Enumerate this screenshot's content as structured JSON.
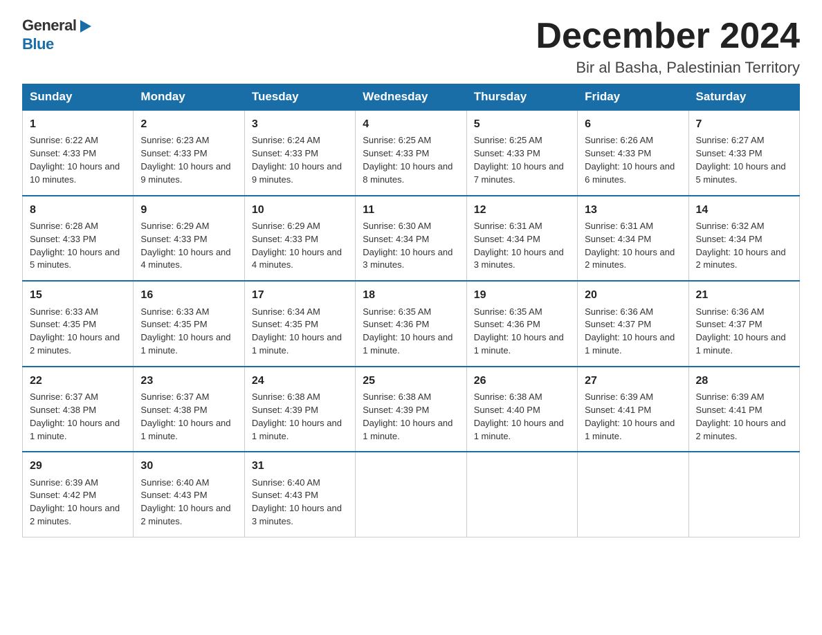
{
  "header": {
    "logo_general": "General",
    "logo_blue": "Blue",
    "month_title": "December 2024",
    "location": "Bir al Basha, Palestinian Territory"
  },
  "days_of_week": [
    "Sunday",
    "Monday",
    "Tuesday",
    "Wednesday",
    "Thursday",
    "Friday",
    "Saturday"
  ],
  "weeks": [
    [
      {
        "day": "1",
        "sunrise": "6:22 AM",
        "sunset": "4:33 PM",
        "daylight": "10 hours and 10 minutes."
      },
      {
        "day": "2",
        "sunrise": "6:23 AM",
        "sunset": "4:33 PM",
        "daylight": "10 hours and 9 minutes."
      },
      {
        "day": "3",
        "sunrise": "6:24 AM",
        "sunset": "4:33 PM",
        "daylight": "10 hours and 9 minutes."
      },
      {
        "day": "4",
        "sunrise": "6:25 AM",
        "sunset": "4:33 PM",
        "daylight": "10 hours and 8 minutes."
      },
      {
        "day": "5",
        "sunrise": "6:25 AM",
        "sunset": "4:33 PM",
        "daylight": "10 hours and 7 minutes."
      },
      {
        "day": "6",
        "sunrise": "6:26 AM",
        "sunset": "4:33 PM",
        "daylight": "10 hours and 6 minutes."
      },
      {
        "day": "7",
        "sunrise": "6:27 AM",
        "sunset": "4:33 PM",
        "daylight": "10 hours and 5 minutes."
      }
    ],
    [
      {
        "day": "8",
        "sunrise": "6:28 AM",
        "sunset": "4:33 PM",
        "daylight": "10 hours and 5 minutes."
      },
      {
        "day": "9",
        "sunrise": "6:29 AM",
        "sunset": "4:33 PM",
        "daylight": "10 hours and 4 minutes."
      },
      {
        "day": "10",
        "sunrise": "6:29 AM",
        "sunset": "4:33 PM",
        "daylight": "10 hours and 4 minutes."
      },
      {
        "day": "11",
        "sunrise": "6:30 AM",
        "sunset": "4:34 PM",
        "daylight": "10 hours and 3 minutes."
      },
      {
        "day": "12",
        "sunrise": "6:31 AM",
        "sunset": "4:34 PM",
        "daylight": "10 hours and 3 minutes."
      },
      {
        "day": "13",
        "sunrise": "6:31 AM",
        "sunset": "4:34 PM",
        "daylight": "10 hours and 2 minutes."
      },
      {
        "day": "14",
        "sunrise": "6:32 AM",
        "sunset": "4:34 PM",
        "daylight": "10 hours and 2 minutes."
      }
    ],
    [
      {
        "day": "15",
        "sunrise": "6:33 AM",
        "sunset": "4:35 PM",
        "daylight": "10 hours and 2 minutes."
      },
      {
        "day": "16",
        "sunrise": "6:33 AM",
        "sunset": "4:35 PM",
        "daylight": "10 hours and 1 minute."
      },
      {
        "day": "17",
        "sunrise": "6:34 AM",
        "sunset": "4:35 PM",
        "daylight": "10 hours and 1 minute."
      },
      {
        "day": "18",
        "sunrise": "6:35 AM",
        "sunset": "4:36 PM",
        "daylight": "10 hours and 1 minute."
      },
      {
        "day": "19",
        "sunrise": "6:35 AM",
        "sunset": "4:36 PM",
        "daylight": "10 hours and 1 minute."
      },
      {
        "day": "20",
        "sunrise": "6:36 AM",
        "sunset": "4:37 PM",
        "daylight": "10 hours and 1 minute."
      },
      {
        "day": "21",
        "sunrise": "6:36 AM",
        "sunset": "4:37 PM",
        "daylight": "10 hours and 1 minute."
      }
    ],
    [
      {
        "day": "22",
        "sunrise": "6:37 AM",
        "sunset": "4:38 PM",
        "daylight": "10 hours and 1 minute."
      },
      {
        "day": "23",
        "sunrise": "6:37 AM",
        "sunset": "4:38 PM",
        "daylight": "10 hours and 1 minute."
      },
      {
        "day": "24",
        "sunrise": "6:38 AM",
        "sunset": "4:39 PM",
        "daylight": "10 hours and 1 minute."
      },
      {
        "day": "25",
        "sunrise": "6:38 AM",
        "sunset": "4:39 PM",
        "daylight": "10 hours and 1 minute."
      },
      {
        "day": "26",
        "sunrise": "6:38 AM",
        "sunset": "4:40 PM",
        "daylight": "10 hours and 1 minute."
      },
      {
        "day": "27",
        "sunrise": "6:39 AM",
        "sunset": "4:41 PM",
        "daylight": "10 hours and 1 minute."
      },
      {
        "day": "28",
        "sunrise": "6:39 AM",
        "sunset": "4:41 PM",
        "daylight": "10 hours and 2 minutes."
      }
    ],
    [
      {
        "day": "29",
        "sunrise": "6:39 AM",
        "sunset": "4:42 PM",
        "daylight": "10 hours and 2 minutes."
      },
      {
        "day": "30",
        "sunrise": "6:40 AM",
        "sunset": "4:43 PM",
        "daylight": "10 hours and 2 minutes."
      },
      {
        "day": "31",
        "sunrise": "6:40 AM",
        "sunset": "4:43 PM",
        "daylight": "10 hours and 3 minutes."
      },
      null,
      null,
      null,
      null
    ]
  ],
  "labels": {
    "sunrise_label": "Sunrise: ",
    "sunset_label": "Sunset: ",
    "daylight_label": "Daylight: "
  }
}
